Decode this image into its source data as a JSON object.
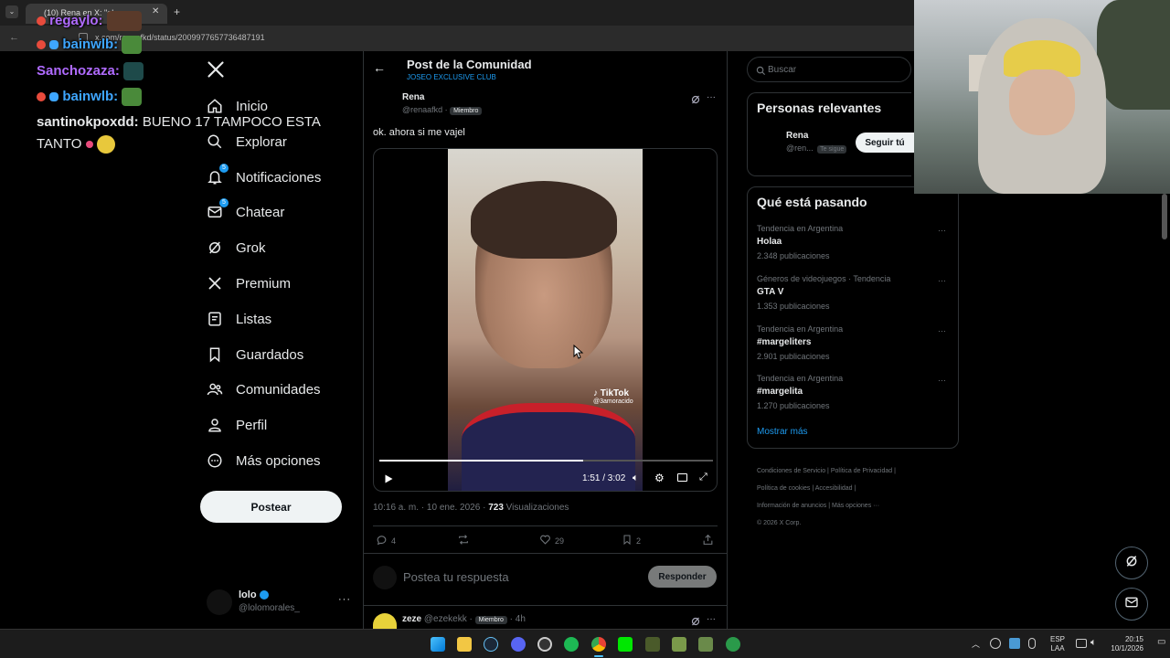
{
  "browser": {
    "tab_title": "(10) Rena en X: \"ok",
    "url": "x.com/renaafkd/status/2009977657736487191"
  },
  "chat_overlay": {
    "messages": [
      {
        "user": "regaylo:",
        "text": "",
        "color": "#b06bff"
      },
      {
        "user": "bainwlb:",
        "text": "",
        "color": "#3ea6ff"
      },
      {
        "user": "Sanchozaza:",
        "text": "",
        "color": "#b06bff"
      },
      {
        "user": "bainwlb:",
        "text": "",
        "color": "#3ea6ff"
      },
      {
        "user": "santinokpoxdd:",
        "text": "BUENO 17 TAMPOCO ESTA",
        "color": "#ffffff"
      },
      {
        "user": "",
        "text": "TANTO",
        "color": "#ffffff"
      }
    ]
  },
  "sidebar": {
    "logo": "x-logo-icon",
    "items": [
      {
        "label": "Inicio",
        "icon": "home-icon"
      },
      {
        "label": "Explorar",
        "icon": "search-icon"
      },
      {
        "label": "Notificaciones",
        "icon": "bell-icon",
        "badge": "5"
      },
      {
        "label": "Chatear",
        "icon": "mail-icon",
        "badge": "5"
      },
      {
        "label": "Grok",
        "icon": "grok-icon"
      },
      {
        "label": "Premium",
        "icon": "x-logo-icon"
      },
      {
        "label": "Listas",
        "icon": "list-icon"
      },
      {
        "label": "Guardados",
        "icon": "bookmark-icon"
      },
      {
        "label": "Comunidades",
        "icon": "people-icon"
      },
      {
        "label": "Perfil",
        "icon": "person-icon"
      },
      {
        "label": "Más opciones",
        "icon": "more-circle-icon"
      }
    ],
    "post_button": "Postear",
    "account": {
      "name": "lolo",
      "handle": "@lolomorales_"
    }
  },
  "post": {
    "header_title": "Post de la Comunidad",
    "header_subtitle": "JOSEO EXCLUSIVE CLUB",
    "author_name": "Rena",
    "author_handle": "@renaafkd",
    "member_badge": "Miembro",
    "text": "ok. ahora si me vajel",
    "video": {
      "tiktok_label": "TikTok",
      "tiktok_handle": "@3amoracido",
      "time": "1:51 / 3:02",
      "progress": 0.61
    },
    "timestamp": "10:16 a. m. · 10 ene. 2026 · ",
    "views_count": "723",
    "views_label": " Visualizaciones",
    "actions": {
      "replies": "4",
      "reposts": "",
      "likes": "29",
      "bookmarks": "2"
    },
    "reply_placeholder": "Postea tu respuesta",
    "reply_button": "Responder"
  },
  "next_reply": {
    "name": "zeze",
    "handle": "@ezekekk",
    "badge": "Miembro",
    "time": "· 4h"
  },
  "right": {
    "search_placeholder": "Buscar",
    "relevant_title": "Personas relevantes",
    "relevant_person": {
      "name": "Rena",
      "handle": "@ren...",
      "follows_you": "Te sigue",
      "button": "Seguir tú"
    },
    "trends_title": "Qué está pasando",
    "trends": [
      {
        "meta": "Tendencia en Argentina",
        "name": "Holaa",
        "count": "2.348 publicaciones"
      },
      {
        "meta": "Géneros de videojuegos · Tendencia",
        "name": "GTA V",
        "count": "1.353 publicaciones"
      },
      {
        "meta": "Tendencia en Argentina",
        "name": "#margeliters",
        "count": "2.901 publicaciones"
      },
      {
        "meta": "Tendencia en Argentina",
        "name": "#margelita",
        "count": "1.270 publicaciones"
      }
    ],
    "show_more": "Mostrar más",
    "footer": [
      "Condiciones de Servicio",
      "Política de Privacidad",
      "Política de cookies",
      "Accesibilidad",
      "Información de anuncios",
      "Más opciones ···",
      "© 2026 X Corp."
    ]
  },
  "taskbar": {
    "lang1": "ESP",
    "lang2": "LAA",
    "time": "20:15",
    "date": "10/1/2026"
  },
  "colors": {
    "accent": "#1d9bf0",
    "background": "#000000",
    "border": "#2f3336",
    "muted": "#71767b"
  }
}
